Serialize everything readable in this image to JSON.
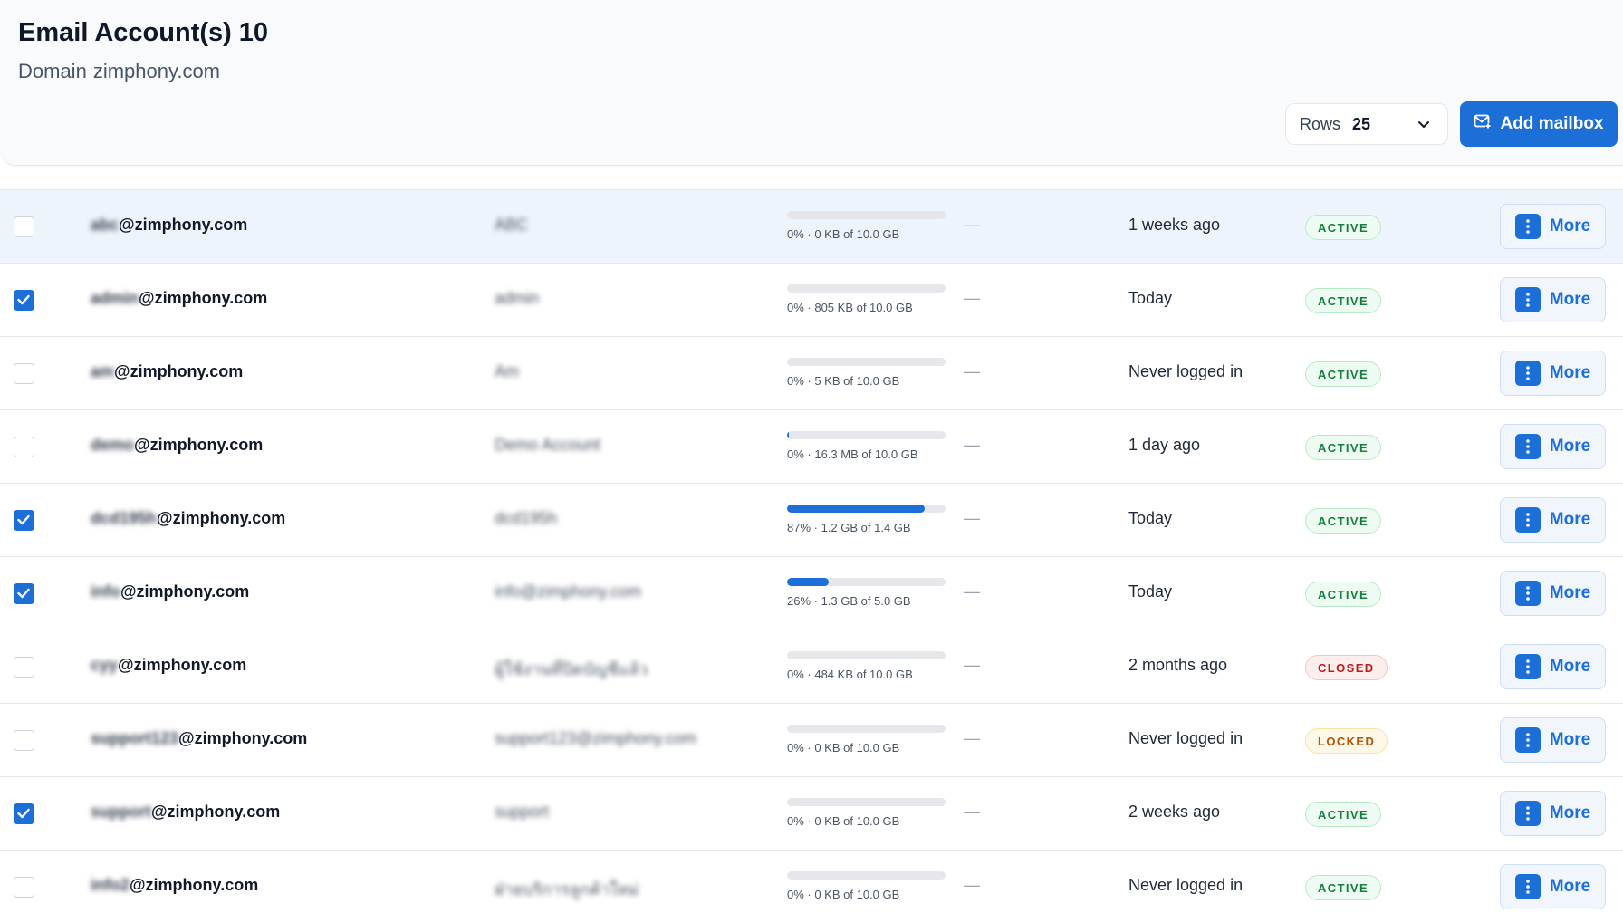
{
  "header": {
    "title": "Email Account(s)",
    "count": "10",
    "domain_label": "Domain",
    "domain": "zimphony.com"
  },
  "toolbar": {
    "rows_label": "Rows",
    "rows_value": "25",
    "add_label": "Add mailbox"
  },
  "accounts": [
    {
      "local": "abc",
      "domain": "@zimphony.com",
      "display_name": "ABC",
      "usage_percent": 0,
      "usage_text": "0% · 0 KB of 10.0 GB",
      "dash": "—",
      "last_login": "1 weeks ago",
      "status": "ACTIVE",
      "checked": false,
      "more_label": "More"
    },
    {
      "local": "admin",
      "domain": "@zimphony.com",
      "display_name": "admin",
      "usage_percent": 0,
      "usage_text": "0% · 805 KB of 10.0 GB",
      "dash": "—",
      "last_login": "Today",
      "status": "ACTIVE",
      "checked": true,
      "more_label": "More"
    },
    {
      "local": "am",
      "domain": "@zimphony.com",
      "display_name": "Am",
      "usage_percent": 0,
      "usage_text": "0% · 5 KB of 10.0 GB",
      "dash": "—",
      "last_login": "Never logged in",
      "status": "ACTIVE",
      "checked": false,
      "more_label": "More"
    },
    {
      "local": "demo",
      "domain": "@zimphony.com",
      "display_name": "Demo Account",
      "usage_percent": 1,
      "usage_text": "0% · 16.3 MB of 10.0 GB",
      "dash": "—",
      "last_login": "1 day ago",
      "status": "ACTIVE",
      "checked": false,
      "more_label": "More"
    },
    {
      "local": "dcd195h",
      "domain": "@zimphony.com",
      "display_name": "dcd195h",
      "usage_percent": 87,
      "usage_text": "87% · 1.2 GB of 1.4 GB",
      "dash": "—",
      "last_login": "Today",
      "status": "ACTIVE",
      "checked": true,
      "more_label": "More"
    },
    {
      "local": "info",
      "domain": "@zimphony.com",
      "display_name": "info@zimphony.com",
      "usage_percent": 26,
      "usage_text": "26% · 1.3 GB of 5.0 GB",
      "dash": "—",
      "last_login": "Today",
      "status": "ACTIVE",
      "checked": true,
      "more_label": "More"
    },
    {
      "local": "cyy",
      "domain": "@zimphony.com",
      "display_name": "ผู้ใช้งานที่ปิดบัญชีแล้ว",
      "usage_percent": 0,
      "usage_text": "0% · 484 KB of 10.0 GB",
      "dash": "—",
      "last_login": "2 months ago",
      "status": "CLOSED",
      "checked": false,
      "more_label": "More"
    },
    {
      "local": "support123",
      "domain": "@zimphony.com",
      "display_name": "support123@zimphony.com",
      "usage_percent": 0,
      "usage_text": "0% · 0 KB of 10.0 GB",
      "dash": "—",
      "last_login": "Never logged in",
      "status": "LOCKED",
      "checked": false,
      "more_label": "More"
    },
    {
      "local": "support",
      "domain": "@zimphony.com",
      "display_name": "support",
      "usage_percent": 0,
      "usage_text": "0% · 0 KB of 10.0 GB",
      "dash": "—",
      "last_login": "2 weeks ago",
      "status": "ACTIVE",
      "checked": true,
      "more_label": "More"
    },
    {
      "local": "info2",
      "domain": "@zimphony.com",
      "display_name": "ฝ่ายบริการลูกค้าใหม่",
      "usage_percent": 0,
      "usage_text": "0% · 0 KB of 10.0 GB",
      "dash": "—",
      "last_login": "Never logged in",
      "status": "ACTIVE",
      "checked": false,
      "more_label": "More"
    }
  ],
  "colors": {
    "primary": "#1d6fd8",
    "active": "#15803d",
    "closed": "#b91c1c",
    "locked": "#b45309"
  }
}
